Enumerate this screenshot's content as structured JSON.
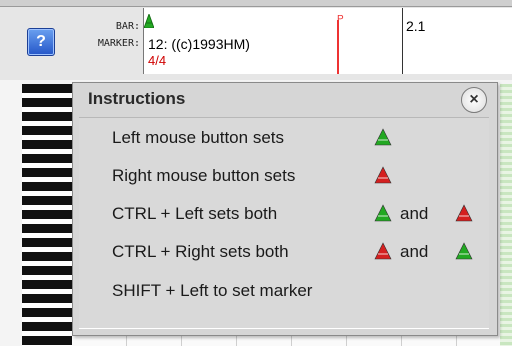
{
  "toolbar": {
    "help_glyph": "?",
    "bar_label": "BAR:",
    "marker_label": "MARKER:"
  },
  "timeline": {
    "bar_text": "12: ((c)1993HM)",
    "time_signature": "4/4",
    "marker_flag": "P",
    "measure_label": "2.1",
    "marker_color": "#e33333"
  },
  "dialog": {
    "title": "Instructions",
    "close_glyph": "×",
    "rows": [
      {
        "text": "Left mouse button sets",
        "icons": [
          "green-triangle-icon"
        ]
      },
      {
        "text": "Right mouse button sets",
        "icons": [
          "red-triangle-icon"
        ]
      },
      {
        "text": "CTRL + Left sets both",
        "icons": [
          "green-triangle-icon",
          "red-triangle-icon"
        ],
        "joiner": "and"
      },
      {
        "text": "CTRL + Right  sets both",
        "icons": [
          "red-triangle-icon",
          "green-triangle-icon"
        ],
        "joiner": "and"
      },
      {
        "text": "SHIFT + Left to set marker",
        "icons": []
      }
    ]
  },
  "colors": {
    "green_triangle": "#22a822",
    "red_triangle": "#d42020"
  }
}
